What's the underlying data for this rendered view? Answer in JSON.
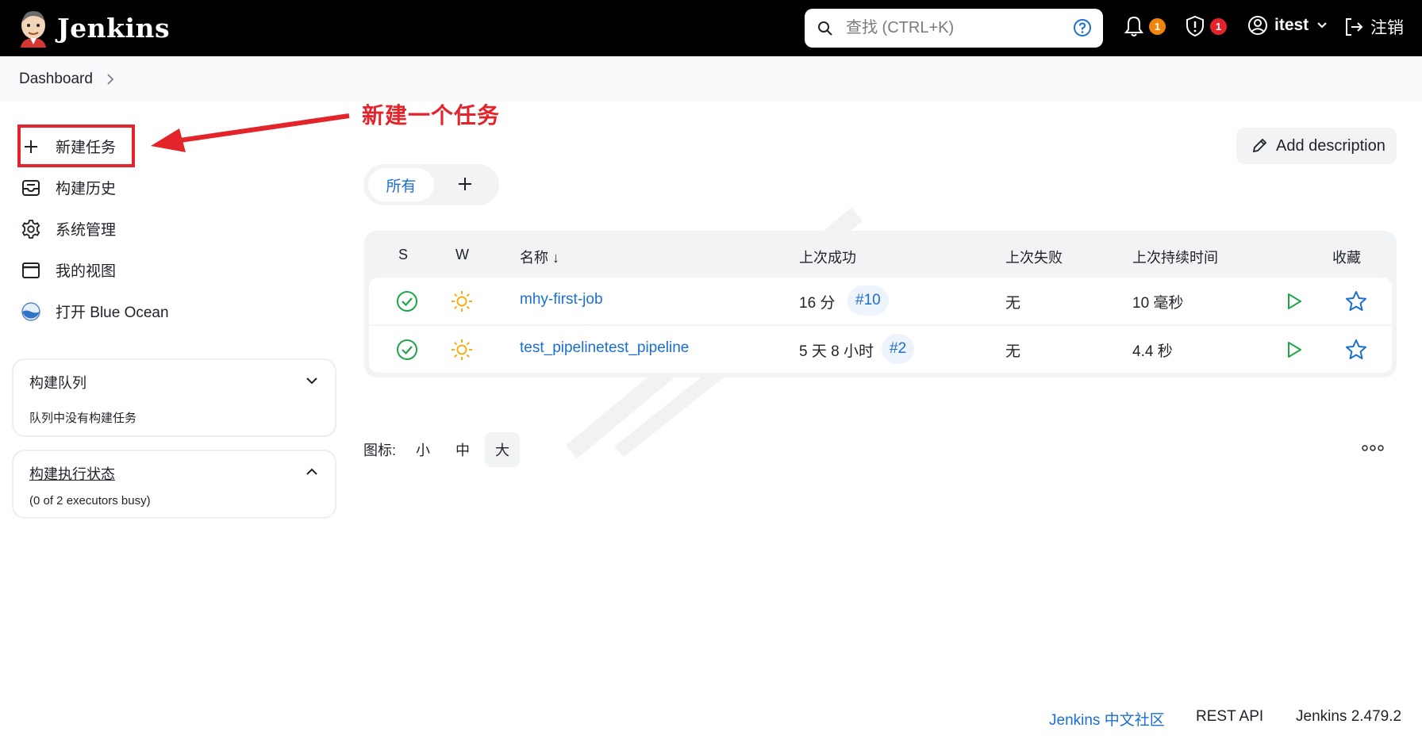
{
  "header": {
    "app_name": "Jenkins",
    "search_placeholder": "查找 (CTRL+K)",
    "notifications_count": "1",
    "security_count": "1",
    "username": "itest",
    "logout_label": "注销"
  },
  "breadcrumb": {
    "items": [
      "Dashboard"
    ]
  },
  "annotation": {
    "text": "新建一个任务"
  },
  "sidebar": {
    "tasks": [
      {
        "label": "新建任务",
        "icon": "plus-icon"
      },
      {
        "label": "构建历史",
        "icon": "inbox-icon"
      },
      {
        "label": "系统管理",
        "icon": "gear-icon"
      },
      {
        "label": "我的视图",
        "icon": "window-icon"
      },
      {
        "label": "打开 Blue Ocean",
        "icon": "blue-ocean-icon"
      }
    ],
    "build_queue": {
      "title": "构建队列",
      "empty_text": "队列中没有构建任务"
    },
    "executors": {
      "title": "构建执行状态",
      "status": "(0 of 2 executors busy)"
    }
  },
  "main": {
    "add_description_label": "Add description",
    "view_tabs": [
      {
        "label": "所有"
      }
    ],
    "table": {
      "headers": [
        "S",
        "W",
        "名称 ↓",
        "上次成功",
        "上次失败",
        "上次持续时间",
        "收藏"
      ],
      "rows": [
        {
          "name": "mhy-first-job",
          "last_success": "16 分",
          "last_success_build": "#10",
          "last_failure": "无",
          "last_duration": "10 毫秒"
        },
        {
          "name": "test_pipelinetest_pipeline",
          "last_success": "5 天 8 小时",
          "last_success_build": "#2",
          "last_failure": "无",
          "last_duration": "4.4 秒"
        }
      ]
    },
    "icon_size": {
      "label": "图标:",
      "options": [
        "小",
        "中",
        "大"
      ],
      "selected": "大"
    }
  },
  "footer": {
    "community_link": "Jenkins 中文社区",
    "rest_api": "REST API",
    "version": "Jenkins 2.479.2"
  },
  "colors": {
    "header_bg": "#000000",
    "accent_blue": "#1a6fd0",
    "success_green": "#1ea64b",
    "sun_yellow": "#f3b014",
    "notif_badge": "#f0850a",
    "security_badge": "#e3242b",
    "annotation_red": "#e3242b"
  }
}
